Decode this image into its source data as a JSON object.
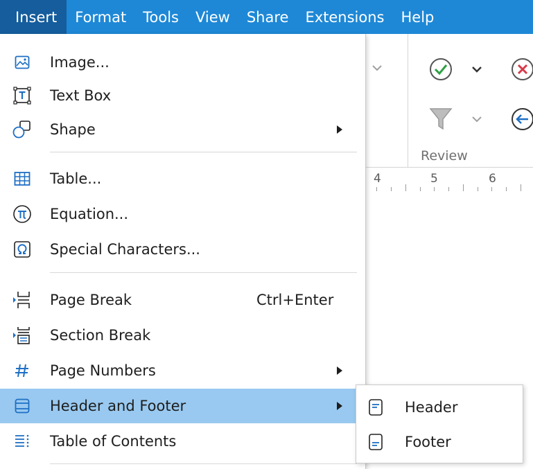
{
  "menubar": {
    "items": [
      "Insert",
      "Format",
      "Tools",
      "View",
      "Share",
      "Extensions",
      "Help"
    ]
  },
  "ribbon": {
    "review_label": "Review",
    "ruler_numbers": [
      "4",
      "5",
      "6"
    ]
  },
  "insert_menu": {
    "items": [
      {
        "label": "Image...",
        "icon": "image-icon"
      },
      {
        "label": "Text Box",
        "icon": "text-box-icon"
      },
      {
        "label": "Shape",
        "icon": "shape-icon",
        "submenu": true
      },
      {
        "label": "Table...",
        "icon": "table-icon"
      },
      {
        "label": "Equation...",
        "icon": "pi-icon"
      },
      {
        "label": "Special Characters...",
        "icon": "omega-icon"
      },
      {
        "label": "Page Break",
        "icon": "page-break-icon",
        "shortcut": "Ctrl+Enter"
      },
      {
        "label": "Section Break",
        "icon": "section-break-icon"
      },
      {
        "label": "Page Numbers",
        "icon": "hash-icon",
        "submenu": true
      },
      {
        "label": "Header and Footer",
        "icon": "header-footer-icon",
        "submenu": true,
        "highlighted": true
      },
      {
        "label": "Table of Contents",
        "icon": "toc-icon"
      }
    ]
  },
  "header_footer_submenu": {
    "items": [
      {
        "label": "Header",
        "icon": "header-icon"
      },
      {
        "label": "Footer",
        "icon": "footer-icon"
      }
    ]
  },
  "colors": {
    "menubar_bg": "#1e88d6",
    "menubar_active": "#155d9c",
    "highlight": "#99c9f0",
    "icon_blue": "#1e6fc4"
  }
}
